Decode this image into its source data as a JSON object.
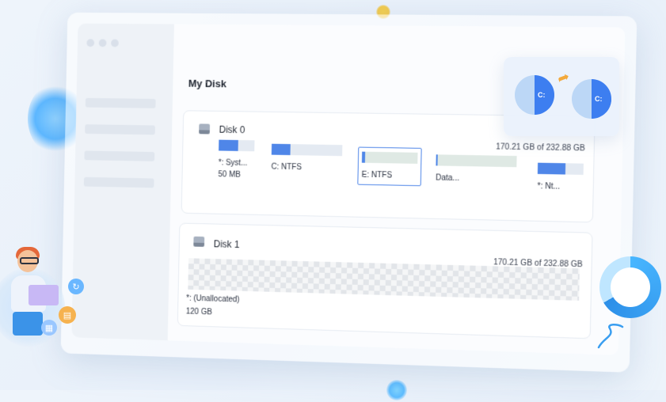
{
  "main": {
    "title": "My Disk"
  },
  "disk0": {
    "label": "Disk 0",
    "capacity": "170.21 GB of 232.88 GB",
    "partitions": [
      {
        "label": "*: Syst...",
        "size": "50 MB",
        "used_fraction": 0.55
      },
      {
        "label": "C: NTFS",
        "used_fraction": 0.3
      },
      {
        "label": "E: NTFS",
        "used_fraction": 0.06,
        "selected": true
      },
      {
        "label": "Data...",
        "used_fraction": 0.02
      },
      {
        "label": "*: Nt...",
        "used_fraction": 0.6
      }
    ]
  },
  "disk1": {
    "label": "Disk 1",
    "capacity": "170.21 GB of 232.88 GB",
    "partition": {
      "label": "*: (Unallocated)",
      "size": "120 GB"
    }
  },
  "float_panel": {
    "left_pie_label": "C:",
    "right_pie_label": "C:"
  },
  "icons": [
    "disk-icon",
    "arrow-icon",
    "refresh-icon",
    "document-icon",
    "grid-icon"
  ],
  "colors": {
    "accent": "#4f86e8",
    "arrow": "#f3a93b"
  }
}
